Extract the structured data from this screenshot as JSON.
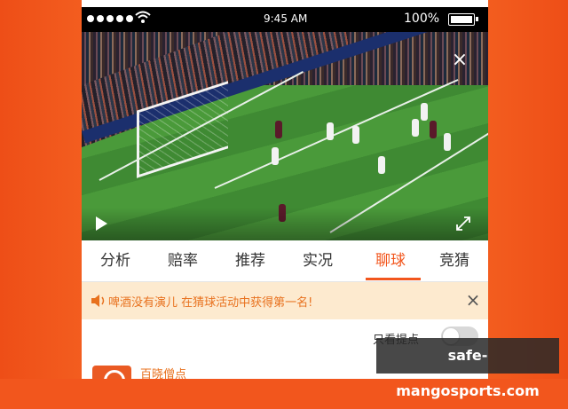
{
  "status_bar": {
    "time": "9:45 AM",
    "battery_percent": "100%",
    "signal_icon": "signal-dots-icon",
    "wifi_icon": "wifi-icon",
    "battery_icon": "battery-icon"
  },
  "video": {
    "close_icon": "×",
    "play_icon": "play-icon",
    "fullscreen_icon": "fullscreen-icon"
  },
  "tabs": [
    {
      "label": "分析",
      "active": false
    },
    {
      "label": "赔率",
      "active": false
    },
    {
      "label": "推荐",
      "active": false
    },
    {
      "label": "实况",
      "active": false
    },
    {
      "label": "聊球",
      "active": true
    },
    {
      "label": "竞猜",
      "active": false
    }
  ],
  "notice": {
    "icon": "speaker-icon",
    "text": "啤酒没有演儿 在猜球活动中获得第一名!",
    "close": "×"
  },
  "filter": {
    "label": "只看提点",
    "toggle_on": false
  },
  "list": [
    {
      "name": "百晓僧点",
      "avatar_icon": "expert-avatar-icon"
    }
  ],
  "watermark": "safe-mangosports.com",
  "colors": {
    "accent": "#f2561d",
    "notice_bg": "#fdeacf",
    "notice_text": "#e8711e"
  }
}
